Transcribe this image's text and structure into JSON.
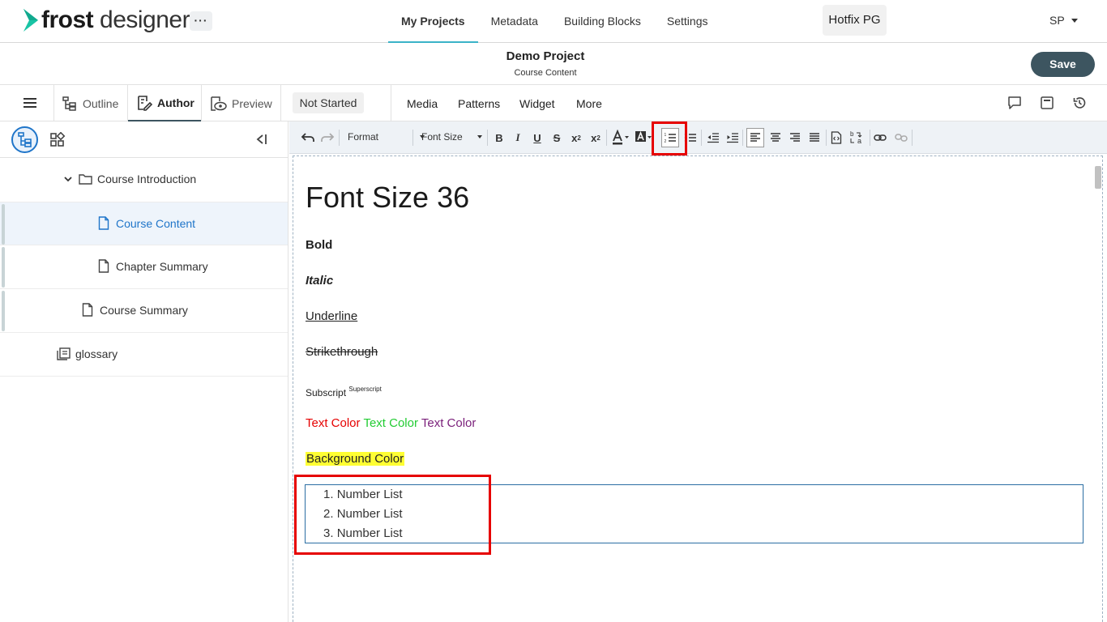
{
  "app": {
    "logo_bold": "frost",
    "logo_light": " designer",
    "more_label": "···",
    "nav": [
      "My Projects",
      "Metadata",
      "Building Blocks",
      "Settings"
    ],
    "workspace": "Hotfix PG",
    "user_initials": "SP",
    "accent_color": "#3bb3c8",
    "logo_color": "#19c4a5"
  },
  "project": {
    "title": "Demo Project",
    "subtitle": "Course Content",
    "save_label": "Save",
    "save_color": "#3d5560"
  },
  "modebar": {
    "tabs": [
      "Outline",
      "Author",
      "Preview"
    ],
    "active_tab": "Author",
    "status": "Not Started",
    "insert_items": [
      "Media",
      "Patterns",
      "Widget",
      "More"
    ],
    "right_icons": [
      "comment-icon",
      "panel-icon",
      "history-icon"
    ]
  },
  "outline": {
    "items": [
      {
        "label": "Course Introduction",
        "icon": "folder-icon",
        "expanded": true
      },
      {
        "label": "Course Content",
        "icon": "page-icon",
        "selected": true
      },
      {
        "label": "Chapter Summary",
        "icon": "page-icon"
      },
      {
        "label": "Course Summary",
        "icon": "page-icon"
      },
      {
        "label": "glossary",
        "icon": "glossary-icon"
      }
    ]
  },
  "toolbar": {
    "format_label": "Format",
    "fontsize_label": "Font Size",
    "bold": "B",
    "italic": "I",
    "underline": "U",
    "strike": "S",
    "subscript": "x",
    "superscript": "x",
    "highlighted_button": "numbered-list-icon"
  },
  "content": {
    "heading": "Font Size 36",
    "bold": "Bold",
    "italic": "Italic",
    "underline": "Underline",
    "strikethrough": "Strikethrough",
    "subscript": "Subscript",
    "superscript": "Superscript",
    "colors": [
      {
        "text": "Text Color",
        "color": "#e60000"
      },
      {
        "text": "Text Color",
        "color": "#22cc33"
      },
      {
        "text": "Text Color",
        "color": "#7a1f7a"
      }
    ],
    "background_color_text": "Background Color",
    "background_color": "#ffff33",
    "number_list": [
      {
        "marker": "1.",
        "text": "Number List"
      },
      {
        "marker": "2.",
        "text": "Number List"
      },
      {
        "marker": "3.",
        "text": "Number List"
      }
    ]
  }
}
